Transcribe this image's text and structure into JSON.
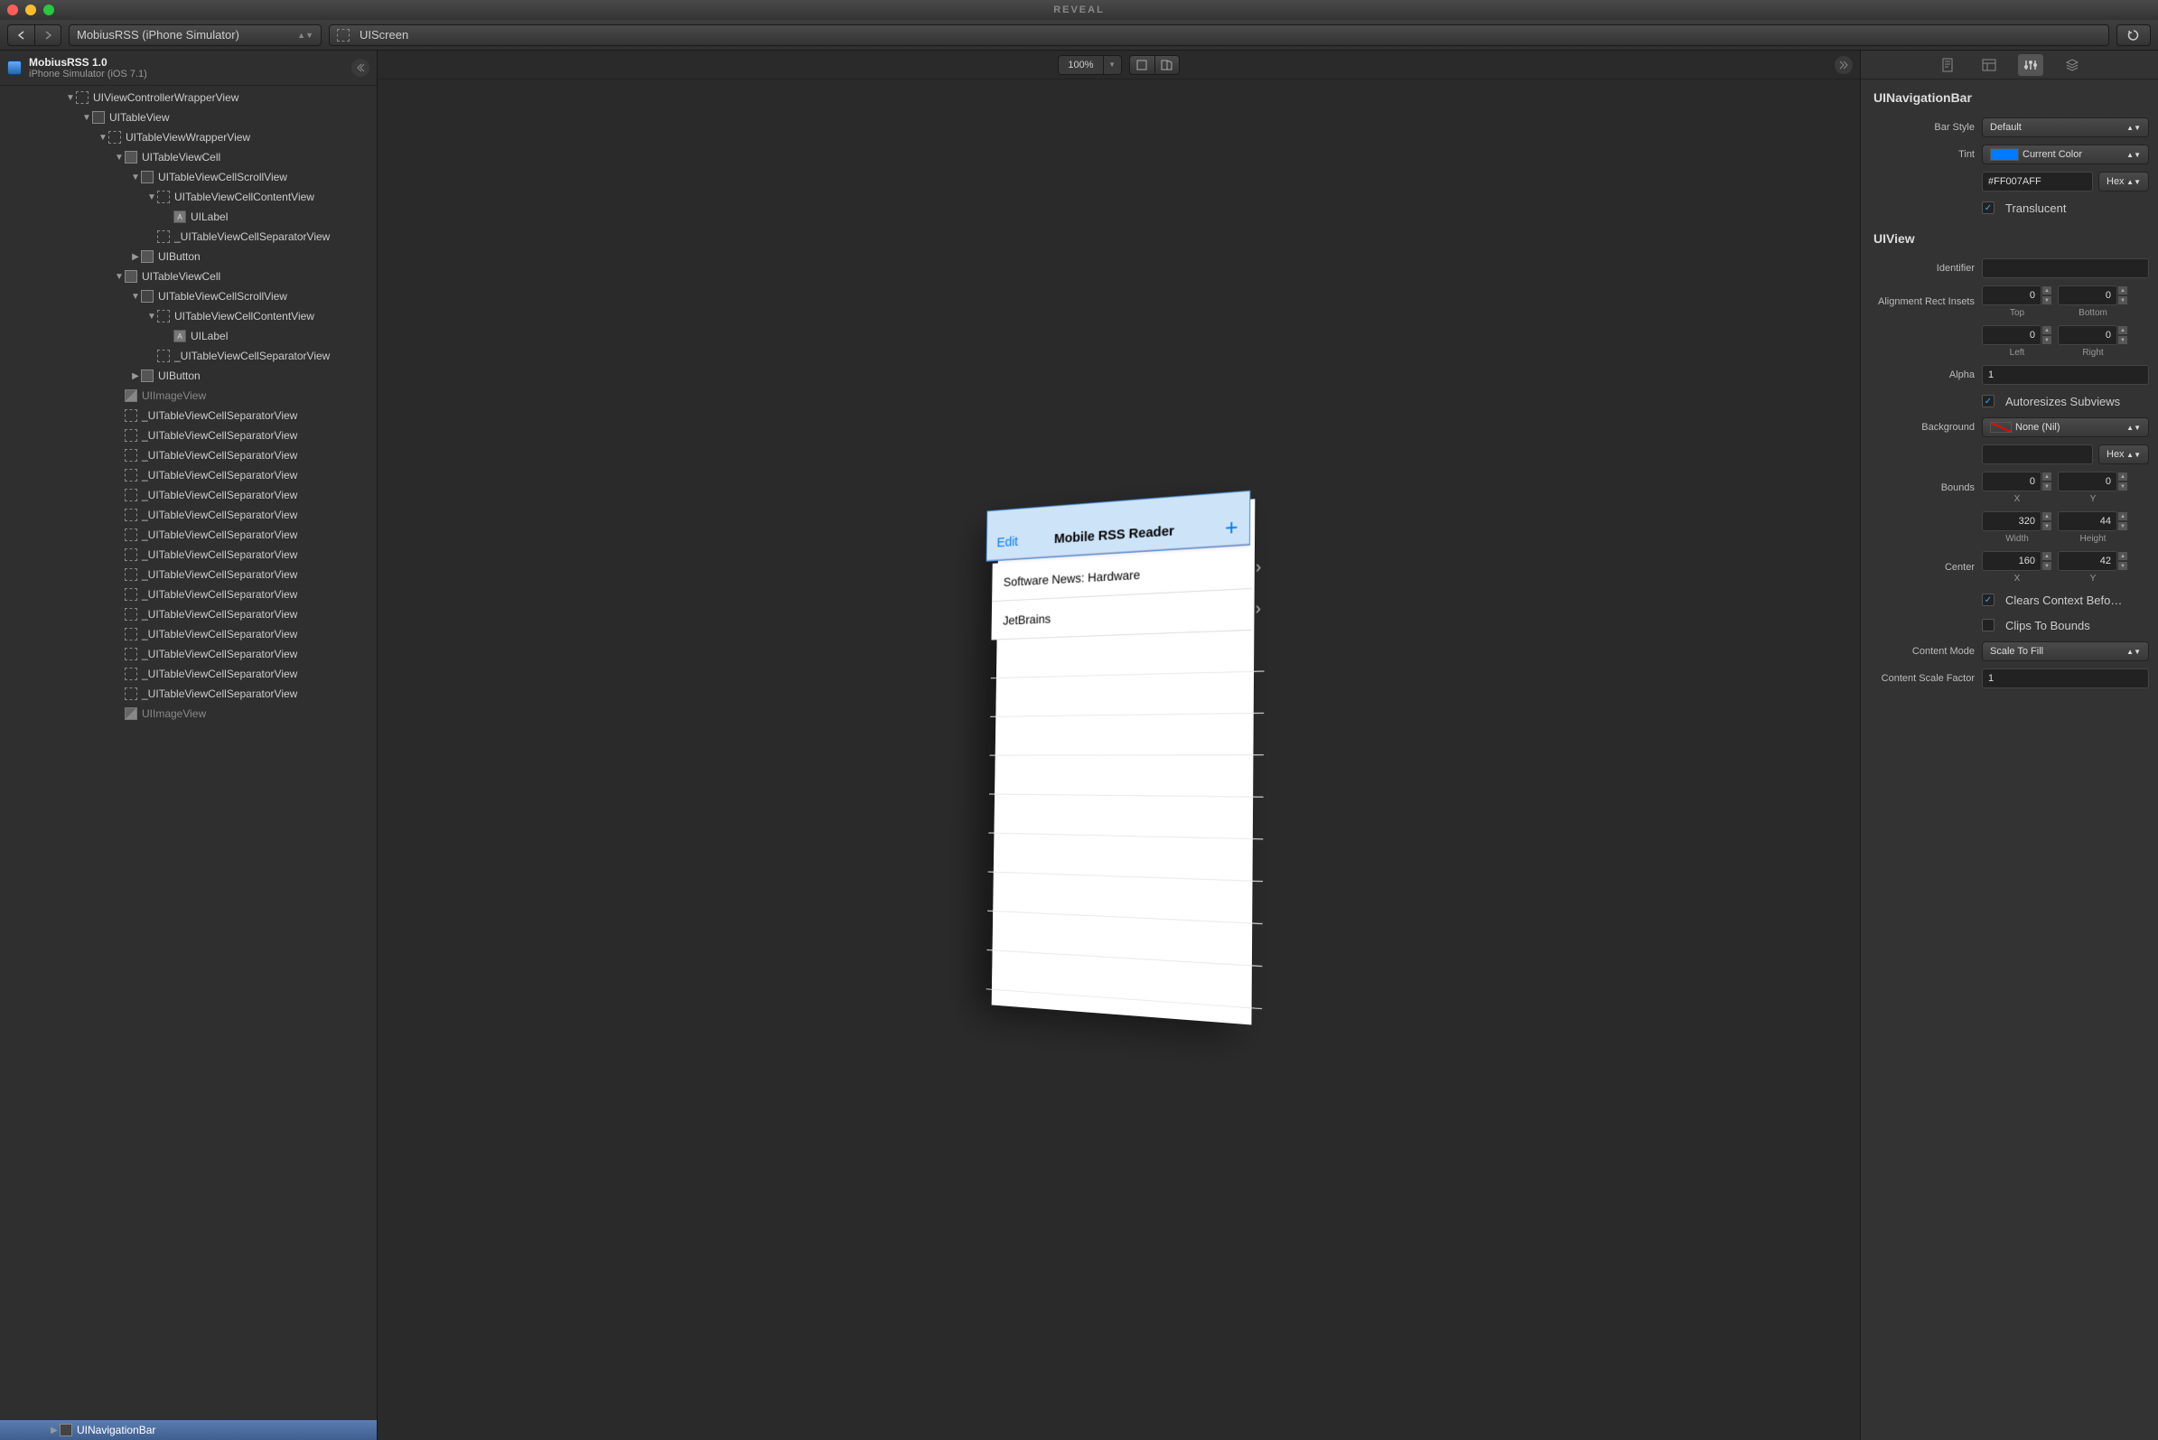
{
  "window": {
    "title": "REVEAL"
  },
  "toolbar": {
    "target": "MobiusRSS (iPhone Simulator)",
    "breadcrumb_root": "UIScreen"
  },
  "sidebar": {
    "app_title": "MobiusRSS 1.0",
    "app_sub": "iPhone Simulator (iOS 7.1)",
    "tree": [
      {
        "d": 4,
        "a": "▼",
        "i": "dashed",
        "t": "UIViewControllerWrapperView"
      },
      {
        "d": 5,
        "a": "▼",
        "i": "stack",
        "t": "UITableView"
      },
      {
        "d": 6,
        "a": "▼",
        "i": "dashed",
        "t": "UITableViewWrapperView"
      },
      {
        "d": 7,
        "a": "▼",
        "i": "solid",
        "t": "UITableViewCell"
      },
      {
        "d": 8,
        "a": "▼",
        "i": "stack",
        "t": "UITableViewCellScrollView"
      },
      {
        "d": 9,
        "a": "▼",
        "i": "dashed",
        "t": "UITableViewCellContentView"
      },
      {
        "d": 10,
        "a": "",
        "i": "label",
        "t": "UILabel"
      },
      {
        "d": 9,
        "a": "",
        "i": "dashed",
        "t": "_UITableViewCellSeparatorView"
      },
      {
        "d": 8,
        "a": "▶",
        "i": "solid",
        "t": "UIButton"
      },
      {
        "d": 7,
        "a": "▼",
        "i": "solid",
        "t": "UITableViewCell"
      },
      {
        "d": 8,
        "a": "▼",
        "i": "stack",
        "t": "UITableViewCellScrollView"
      },
      {
        "d": 9,
        "a": "▼",
        "i": "dashed",
        "t": "UITableViewCellContentView"
      },
      {
        "d": 10,
        "a": "",
        "i": "label",
        "t": "UILabel"
      },
      {
        "d": 9,
        "a": "",
        "i": "dashed",
        "t": "_UITableViewCellSeparatorView"
      },
      {
        "d": 8,
        "a": "▶",
        "i": "solid",
        "t": "UIButton"
      },
      {
        "d": 7,
        "a": "",
        "i": "img",
        "t": "UIImageView",
        "dim": true
      },
      {
        "d": 7,
        "a": "",
        "i": "dashed",
        "t": "_UITableViewCellSeparatorView"
      },
      {
        "d": 7,
        "a": "",
        "i": "dashed",
        "t": "_UITableViewCellSeparatorView"
      },
      {
        "d": 7,
        "a": "",
        "i": "dashed",
        "t": "_UITableViewCellSeparatorView"
      },
      {
        "d": 7,
        "a": "",
        "i": "dashed",
        "t": "_UITableViewCellSeparatorView"
      },
      {
        "d": 7,
        "a": "",
        "i": "dashed",
        "t": "_UITableViewCellSeparatorView"
      },
      {
        "d": 7,
        "a": "",
        "i": "dashed",
        "t": "_UITableViewCellSeparatorView"
      },
      {
        "d": 7,
        "a": "",
        "i": "dashed",
        "t": "_UITableViewCellSeparatorView"
      },
      {
        "d": 7,
        "a": "",
        "i": "dashed",
        "t": "_UITableViewCellSeparatorView"
      },
      {
        "d": 7,
        "a": "",
        "i": "dashed",
        "t": "_UITableViewCellSeparatorView"
      },
      {
        "d": 7,
        "a": "",
        "i": "dashed",
        "t": "_UITableViewCellSeparatorView"
      },
      {
        "d": 7,
        "a": "",
        "i": "dashed",
        "t": "_UITableViewCellSeparatorView"
      },
      {
        "d": 7,
        "a": "",
        "i": "dashed",
        "t": "_UITableViewCellSeparatorView"
      },
      {
        "d": 7,
        "a": "",
        "i": "dashed",
        "t": "_UITableViewCellSeparatorView"
      },
      {
        "d": 7,
        "a": "",
        "i": "dashed",
        "t": "_UITableViewCellSeparatorView"
      },
      {
        "d": 7,
        "a": "",
        "i": "dashed",
        "t": "_UITableViewCellSeparatorView"
      },
      {
        "d": 7,
        "a": "",
        "i": "img",
        "t": "UIImageView",
        "dim": true
      }
    ],
    "selected": {
      "a": "▶",
      "i": "stack",
      "t": "UINavigationBar",
      "d": 3
    }
  },
  "canvas": {
    "zoom": "100%",
    "preview": {
      "edit": "Edit",
      "title": "Mobile RSS Reader",
      "plus": "+",
      "rows": [
        "Software News: Hardware",
        "JetBrains"
      ]
    }
  },
  "inspector": {
    "nav": {
      "heading": "UINavigationBar",
      "bar_style_label": "Bar Style",
      "bar_style": "Default",
      "tint_label": "Tint",
      "tint": "Current Color",
      "tint_hex": "#FF007AFF",
      "hex_label": "Hex",
      "translucent_label": "Translucent",
      "translucent": true
    },
    "view": {
      "heading": "UIView",
      "identifier_label": "Identifier",
      "identifier": "",
      "align_label": "Alignment Rect Insets",
      "top": "0",
      "top_label": "Top",
      "bottom": "0",
      "bottom_label": "Bottom",
      "left": "0",
      "left_label": "Left",
      "right": "0",
      "right_label": "Right",
      "alpha_label": "Alpha",
      "alpha": "1",
      "autoresize_label": "Autoresizes Subviews",
      "autoresize": true,
      "background_label": "Background",
      "background": "None (Nil)",
      "bg_hex_label": "Hex",
      "bounds_label": "Bounds",
      "bx": "0",
      "bx_label": "X",
      "by": "0",
      "by_label": "Y",
      "bw": "320",
      "bw_label": "Width",
      "bh": "44",
      "bh_label": "Height",
      "center_label": "Center",
      "cx": "160",
      "cx_label": "X",
      "cy": "42",
      "cy_label": "Y",
      "clears_label": "Clears Context Befo…",
      "clears": true,
      "clips_label": "Clips To Bounds",
      "clips": false,
      "cmode_label": "Content Mode",
      "cmode": "Scale To Fill",
      "cscale_label": "Content Scale Factor",
      "cscale": "1"
    }
  }
}
